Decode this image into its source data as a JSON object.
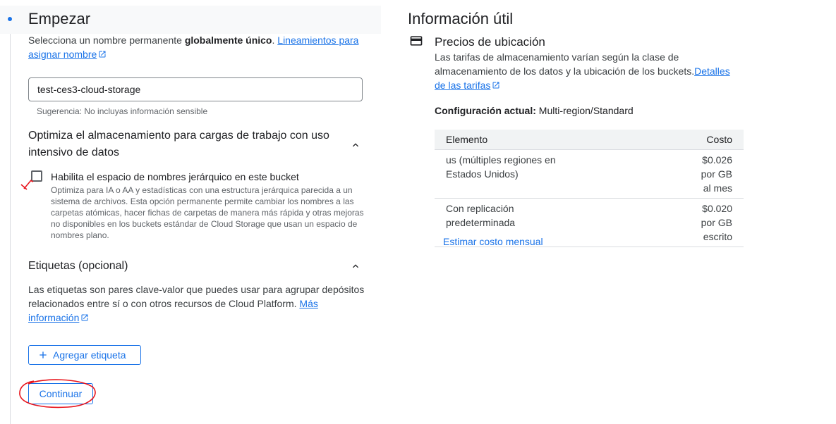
{
  "left": {
    "step_title": "Empezar",
    "intro_text_prefix": "Selecciona un nombre permanente ",
    "intro_text_bold": "globalmente único",
    "intro_text_suffix": ". ",
    "guidelines_link": "Lineamientos para asignar nombre",
    "bucket_name_value": "test-ces3-cloud-storage",
    "hint": "Sugerencia: No incluyas información sensible",
    "optimize_section": {
      "title": "Optimiza el almacenamiento para cargas de trabajo con uso intensivo de datos",
      "checkbox_label": "Habilita el espacio de nombres jerárquico en este bucket",
      "checkbox_description": "Optimiza para IA o AA y estadísticas con una estructura jerárquica parecida a un sistema de archivos. Esta opción permanente permite cambiar los nombres a las carpetas atómicas, hacer fichas de carpetas de manera más rápida y otras mejoras no disponibles en los buckets estándar de Cloud Storage que usan un espacio de nombres plano."
    },
    "labels_section": {
      "title": "Etiquetas (opcional)",
      "description": "Las etiquetas son pares clave-valor que puedes usar para agrupar depósitos relacionados entre sí o con otros recursos de Cloud Platform. ",
      "more_info_link": "Más información",
      "add_label_button": "Agregar etiqueta"
    },
    "continue_button": "Continuar"
  },
  "right": {
    "title": "Información útil",
    "pricing_title": "Precios de ubicación",
    "pricing_text": "Las tarifas de almacenamiento varían según la clase de almacenamiento de los datos y la ubicación de los buckets.",
    "pricing_link": "Detalles de las tarifas",
    "config_label": "Configuración actual:",
    "config_value": " Multi-region/Standard",
    "table": {
      "headers": [
        "Elemento",
        "Costo"
      ],
      "rows": [
        [
          "us (múltiples regiones en Estados Unidos)",
          "$0.026 por GB al mes"
        ],
        [
          "Con replicación predeterminada",
          "$0.020 por GB escrito"
        ]
      ]
    },
    "estimate_link": "Estimar costo mensual"
  },
  "colors": {
    "accent": "#1a73e8",
    "annotation": "#e8141c"
  },
  "icons": [
    "external-link-icon",
    "chevron-up-icon",
    "plus-icon",
    "credit-card-icon"
  ]
}
